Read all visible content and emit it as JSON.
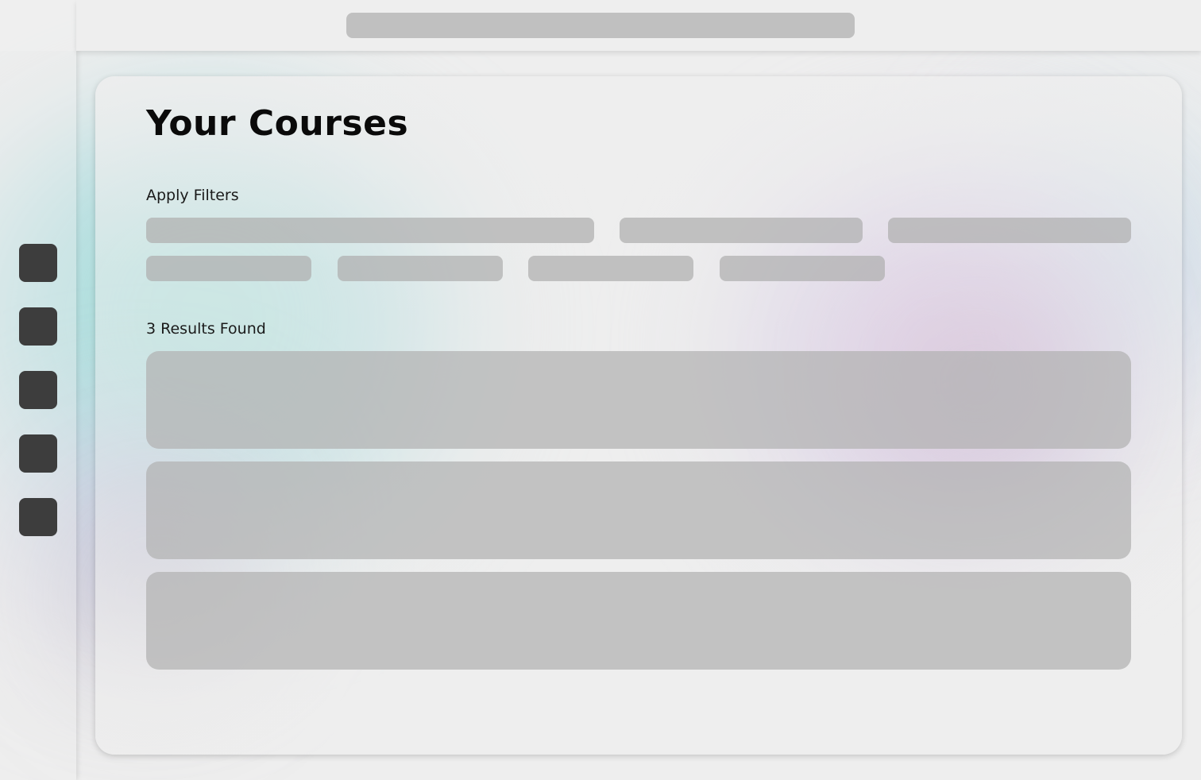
{
  "page": {
    "title": "Your Courses",
    "filters_label": "Apply Filters",
    "results_label": "3 Results Found"
  },
  "colors": {
    "background": "#eeeeee",
    "sidebar_icon": "#3d3d3d",
    "placeholder": "#c0c0c0",
    "accent_teal": "#a7e2d7",
    "accent_pink": "#e3c3e6"
  },
  "sidebar": {
    "items": [
      {
        "icon": "nav-icon-1"
      },
      {
        "icon": "nav-icon-2"
      },
      {
        "icon": "nav-icon-3"
      },
      {
        "icon": "nav-icon-4"
      },
      {
        "icon": "nav-icon-5"
      }
    ]
  },
  "search": {
    "value": "",
    "placeholder": ""
  },
  "filters": {
    "row1": [
      {
        "label": ""
      },
      {
        "label": ""
      },
      {
        "label": ""
      }
    ],
    "row2": [
      {
        "label": ""
      },
      {
        "label": ""
      },
      {
        "label": ""
      },
      {
        "label": ""
      }
    ]
  },
  "results": [
    {
      "title": ""
    },
    {
      "title": ""
    },
    {
      "title": ""
    }
  ]
}
